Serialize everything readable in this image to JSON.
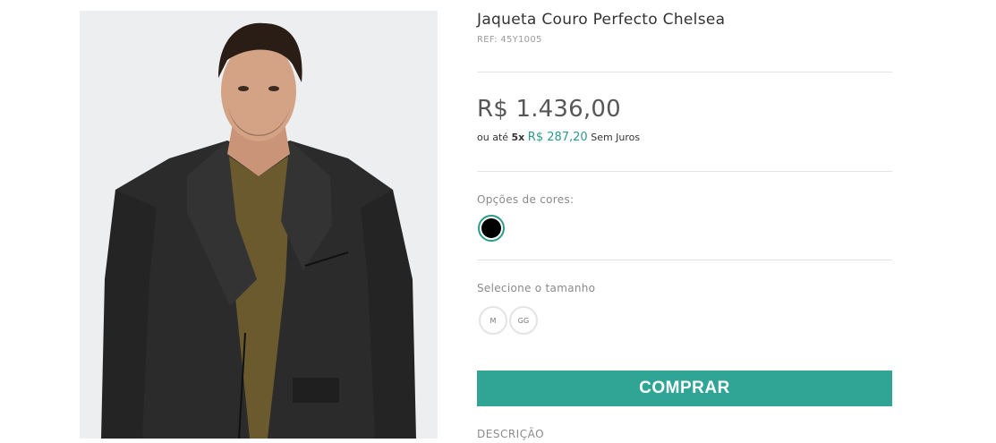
{
  "product": {
    "title": "Jaqueta Couro Perfecto Chelsea",
    "ref": "REF: 45Y1005",
    "image_alt": "product-photo-man-black-leather-jacket"
  },
  "pricing": {
    "price": "R$ 1.436,00",
    "installment_prefix": "ou até",
    "installment_count": "5x",
    "installment_amount": "R$ 287,20",
    "installment_suffix": "Sem Juros"
  },
  "colors": {
    "label": "Opções de cores:",
    "options": [
      {
        "name": "black",
        "hex": "#000000",
        "selected": true
      }
    ]
  },
  "sizes": {
    "label": "Selecione o tamanho",
    "options": [
      "M",
      "GG"
    ]
  },
  "actions": {
    "buy_label": "COMPRAR"
  },
  "description": {
    "heading": "DESCRIÇÃO"
  },
  "theme": {
    "accent": "#31a595",
    "installment_color": "#2e9a88"
  }
}
